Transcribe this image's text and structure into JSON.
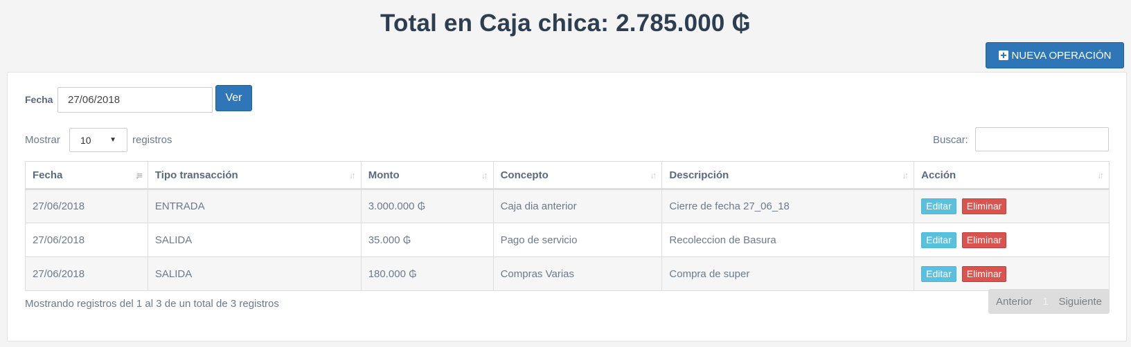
{
  "title": "Total en Caja chica: 2.785.000 ₲",
  "new_button_label": "NUEVA OPERACIÓN",
  "filter": {
    "label": "Fecha",
    "date_value": "27/06/2018",
    "ver_label": "Ver"
  },
  "length": {
    "show_label": "Mostrar",
    "value": "10",
    "records_label": "registros"
  },
  "search": {
    "label": "Buscar:",
    "value": ""
  },
  "table": {
    "headers": [
      "Fecha",
      "Tipo transacción",
      "Monto",
      "Concepto",
      "Descripción",
      "Acción"
    ],
    "rows": [
      {
        "fecha": "27/06/2018",
        "tipo": "ENTRADA",
        "monto": "3.000.000 ₲",
        "concepto": "Caja dia anterior",
        "descripcion": "Cierre de fecha 27_06_18"
      },
      {
        "fecha": "27/06/2018",
        "tipo": "SALIDA",
        "monto": "35.000 ₲",
        "concepto": "Pago de servicio",
        "descripcion": "Recoleccion de Basura"
      },
      {
        "fecha": "27/06/2018",
        "tipo": "SALIDA",
        "monto": "180.000 ₲",
        "concepto": "Compras Varias",
        "descripcion": "Compra de super"
      }
    ],
    "edit_label": "Editar",
    "delete_label": "Eliminar"
  },
  "info": "Mostrando registros del 1 al 3 de un total de 3 registros",
  "pagination": {
    "prev": "Anterior",
    "page": "1",
    "next": "Siguiente"
  },
  "colors": {
    "primary": "#2e76b8",
    "info": "#5bc0de",
    "danger": "#d9534f",
    "title": "#2c3e50"
  }
}
